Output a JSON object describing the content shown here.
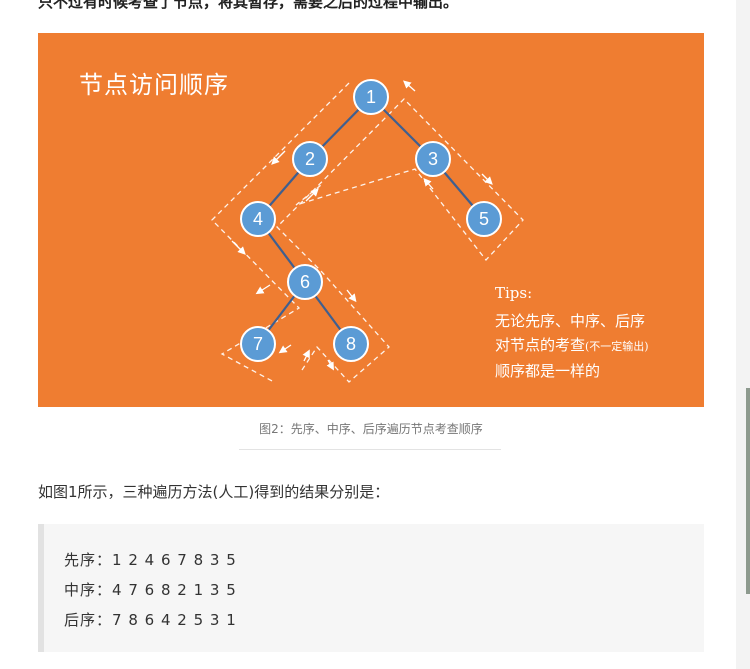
{
  "article": {
    "top_text": "只不过有时候考查了节点，将其暂存，需要之后的过程中输出。",
    "figure": {
      "title": "节点访问顺序",
      "nodes": [
        "1",
        "2",
        "3",
        "4",
        "5",
        "6",
        "7",
        "8"
      ],
      "tips": {
        "title": "Tips:",
        "line1": "无论先序、中序、后序",
        "line2_main": "对节点的考查",
        "line2_small": "(不一定输出)",
        "line3": "顺序都是一样的"
      },
      "colors": {
        "background": "#ef7d31",
        "node_fill": "#5b9bd5",
        "node_border": "#ffffff",
        "edge": "#3f5f8f",
        "path": "#ffffff"
      }
    },
    "caption": "图2：先序、中序、后序遍历节点考查顺序",
    "paragraph": "如图1所示，三种遍历方法(人工)得到的结果分别是：",
    "results": [
      {
        "label": "先序：",
        "sequence": "1 2 4 6 7 8 3 5"
      },
      {
        "label": "中序：",
        "sequence": "4 7 6 8 2 1 3 5"
      },
      {
        "label": "后序：",
        "sequence": "7 8 6 4 2 5 3 1"
      }
    ]
  }
}
